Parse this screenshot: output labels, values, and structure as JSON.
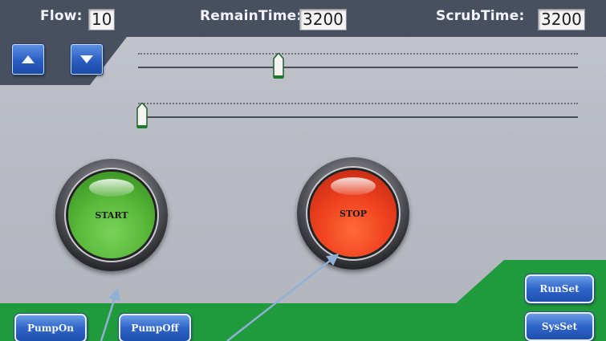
{
  "header": {
    "flow_label": "Flow:",
    "flow_value": "10",
    "remain_label": "RemainTime:",
    "remain_value": "3200",
    "scrub_label": "ScrubTime:",
    "scrub_value": "3200"
  },
  "controls": {
    "up_icon": "triangle-up-icon",
    "down_icon": "triangle-down-icon"
  },
  "sliders": [
    {
      "name": "flow-slider",
      "level": 0.32
    },
    {
      "name": "secondary-slider",
      "level": 0.01
    }
  ],
  "buttons": {
    "start_label": "START",
    "stop_label": "STOP",
    "pump_on_label": "PumpOn",
    "pump_off_label": "PumpOff",
    "run_set_label": "RunSet",
    "sys_set_label": "SysSet"
  },
  "colors": {
    "header_bar": "#485060",
    "footer_green": "#1f9a3c",
    "start_green": "#58b93a",
    "stop_red": "#f0421f",
    "button_blue": "#2f64c8",
    "annotation_arrow": "#8fb0d4"
  }
}
